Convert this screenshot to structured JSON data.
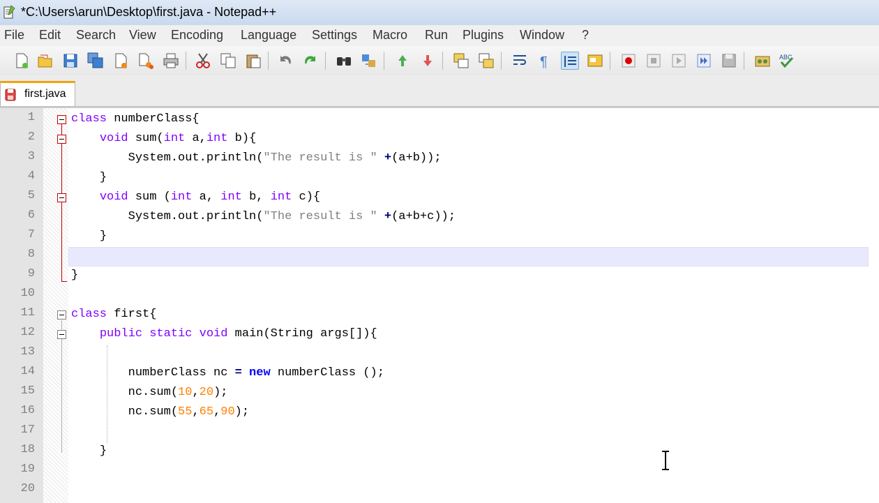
{
  "window": {
    "title": "*C:\\Users\\arun\\Desktop\\first.java - Notepad++"
  },
  "menu": [
    "File",
    "Edit",
    "Search",
    "View",
    "Encoding",
    "Language",
    "Settings",
    "Macro",
    "Run",
    "Plugins",
    "Window",
    "?"
  ],
  "toolbar": {
    "icons": [
      "new-file-icon",
      "open-file-icon",
      "save-icon",
      "save-all-icon",
      "close-icon",
      "close-all-icon",
      "print-icon",
      "cut-icon",
      "copy-icon",
      "paste-icon",
      "undo-icon",
      "redo-icon",
      "find-icon",
      "replace-icon",
      "zoom-in-icon",
      "zoom-out-icon",
      "sync-vertical-icon",
      "sync-horizontal-icon",
      "word-wrap-icon",
      "show-all-characters-icon",
      "indent-guide-icon",
      "user-language-icon",
      "macro-record-icon",
      "macro-stop-icon",
      "macro-play-icon",
      "macro-run-multiple-icon",
      "macro-save-icon",
      "launch-browser-icon",
      "spell-check-icon"
    ]
  },
  "tabs": [
    {
      "label": "first.java",
      "modified": true
    }
  ],
  "editor": {
    "line_numbers": [
      "1",
      "2",
      "3",
      "4",
      "5",
      "6",
      "7",
      "8",
      "9",
      "10",
      "11",
      "12",
      "13",
      "14",
      "15",
      "16",
      "17",
      "18",
      "19",
      "20"
    ],
    "lines": {
      "l1": {
        "kw": "class",
        "rest": " numberClass{"
      },
      "l2": {
        "kw1": "void",
        "a": " sum(",
        "kw2": "int",
        "b": " a,",
        "kw3": "int",
        "c": " b){"
      },
      "l3": {
        "a": "System.out.println(",
        "str": "\"The result is \"",
        "op": " +",
        "b": "(a+b));"
      },
      "l4": {
        "a": "}"
      },
      "l5": {
        "kw1": "void",
        "a": " sum (",
        "kw2": "int",
        "b": " a, ",
        "kw3": "int",
        "c": " b, ",
        "kw4": "int",
        "d": " c){"
      },
      "l6": {
        "a": "System.out.println(",
        "str": "\"The result is \"",
        "op": " +",
        "b": "(a+b+c));"
      },
      "l7": {
        "a": "}"
      },
      "l8": {
        "a": ""
      },
      "l9": {
        "a": "}"
      },
      "l10": {
        "a": ""
      },
      "l11": {
        "kw": "class",
        "rest": " first{"
      },
      "l12": {
        "kw1": "public",
        "kw2": "static",
        "kw3": "void",
        "a": " main(String args[]){"
      },
      "l13": {
        "a": ""
      },
      "l14": {
        "a": "numberClass nc ",
        "op": "=",
        "new": " new",
        "b": " numberClass ();"
      },
      "l15": {
        "a": "nc.sum(",
        "n1": "10",
        "c1": ",",
        "n2": "20",
        "b": ");"
      },
      "l16": {
        "a": "nc.sum(",
        "n1": "55",
        "c1": ",",
        "n2": "65",
        "c2": ",",
        "n3": "90",
        "b": ");"
      },
      "l17": {
        "a": ""
      },
      "l18": {
        "a": "}"
      },
      "l19": {
        "a": ""
      },
      "l20": {
        "a": ""
      }
    },
    "current_line": 8
  },
  "colors": {
    "keyword": "#8000ff",
    "string": "#808080",
    "number": "#ff8000",
    "operator": "#000080",
    "tab_accent": "#f0a30a",
    "current_line": "#e8e8ff"
  }
}
